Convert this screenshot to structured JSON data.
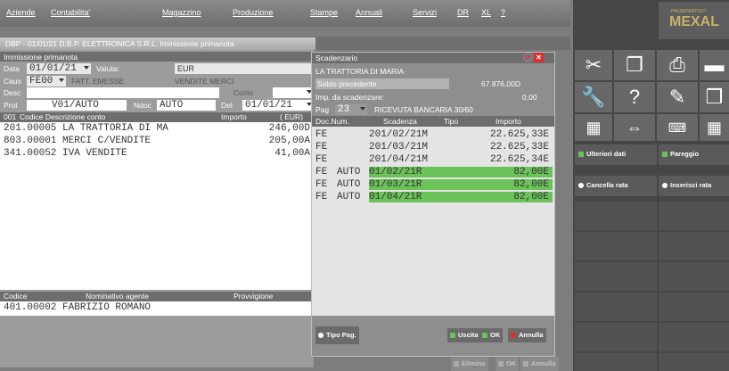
{
  "menubar": {
    "items": [
      "Aziende",
      "Contabilita'",
      "Magazzino",
      "Produzione",
      "Stampe",
      "Annuali",
      "Servizi",
      "DR",
      "XL",
      "?"
    ]
  },
  "tab": {
    "title": "DBP - 01/01/21  D.B.P. ELETTRONICA S.R.L.  Immissione primanota"
  },
  "form": {
    "title": "Immissione primanota",
    "data_label": "Data",
    "data_value": "01/01/21",
    "valuta_label": "Valuta:",
    "valuta_value": "EUR",
    "caus_label": "Caus",
    "caus_value": "FE00",
    "caus_desc": "FATT. EMESSE",
    "caus_type": "VENDITE MERCI",
    "desc_label": "Desc",
    "colric_label": "Co/ric",
    "prot_label": "Prot",
    "prot_value": "V01/AUTO",
    "ndoc_label": "Ndoc",
    "ndoc_value": "AUTO",
    "del_label": "Del",
    "del_value": "01/01/21",
    "grid_header": {
      "num": "001",
      "codice": "Codice Descrizione conto",
      "importo": "Importo",
      "valuta": "( EUR)"
    },
    "rows": [
      {
        "conto": "201.00005 LA TRATTORIA DI MA",
        "importo": "246,00D"
      },
      {
        "conto": "803.00001 MERCI C/VENDITE",
        "importo": "205,00A"
      },
      {
        "conto": "341.00052 IVA VENDITE",
        "importo": "41,00A"
      }
    ],
    "agent_header": {
      "codice": "Codice",
      "nominativo": "Nominativo agente",
      "provvigione": "Provvigione"
    },
    "agent_row": "401.00002 FABRIZIO ROMANO"
  },
  "scadenzario": {
    "title": "Scadenzario",
    "cliente": "LA TRATTORIA DI MARIA",
    "saldo_label": "Saldo precedente",
    "saldo_value": "67.876,00D",
    "imp_label": "Imp. da scadenzare:",
    "imp_value": "0,00",
    "pag_label": "Pag",
    "pag_value": "23",
    "pag_desc": "RICEVUTA BANCARIA 30/60",
    "headers": {
      "docnum": "Doc.Num.",
      "scadenza": "Scadenza",
      "tipo": "Tipo",
      "importo": "Importo"
    },
    "rows": [
      {
        "tipo_doc": "FE",
        "num": "",
        "scadenza": "201/02/21M",
        "importo": "22.625,33E",
        "highlight": false
      },
      {
        "tipo_doc": "FE",
        "num": "",
        "scadenza": "201/03/21M",
        "importo": "22.625,33E",
        "highlight": false
      },
      {
        "tipo_doc": "FE",
        "num": "",
        "scadenza": "201/04/21M",
        "importo": "22.625,34E",
        "highlight": false
      },
      {
        "tipo_doc": "FE",
        "num": "AUTO",
        "scadenza": "01/02/21R",
        "importo": "82,00E",
        "highlight": true
      },
      {
        "tipo_doc": "FE",
        "num": "AUTO",
        "scadenza": "01/03/21R",
        "importo": "82,00E",
        "highlight": true
      },
      {
        "tipo_doc": "FE",
        "num": "AUTO",
        "scadenza": "01/04/21R",
        "importo": "82,00E",
        "highlight": true
      }
    ],
    "btn_tipo_pag": "Tipo Pag.",
    "btn_uscita": "Uscita",
    "btn_ok": "OK",
    "btn_annulla": "Annulla"
  },
  "bottom_buttons": {
    "elimina": "Elimina",
    "ok": "OK",
    "annulla": "Annulla"
  },
  "right_panel": {
    "logo_small": "PASSEPARTOUT",
    "logo": "MEXAL",
    "ulteriori_dati": "Ulteriori dati",
    "pareggio": "Pareggio",
    "cancella_rata": "Cancella rata",
    "inserisci_rata": "Inserisci rata"
  },
  "colors": {
    "highlight_green": "#4caf50",
    "close_red": "#d93030",
    "accent_green": "#6ac259"
  },
  "icons": [
    "scissors-icon",
    "copy-icon",
    "printer-icon",
    "wrench-icon",
    "help-icon",
    "edit-icon",
    "calculator-icon",
    "expand-icon",
    "keyboard-icon",
    "grid-icon",
    "refresh-icon",
    "close-icon"
  ]
}
